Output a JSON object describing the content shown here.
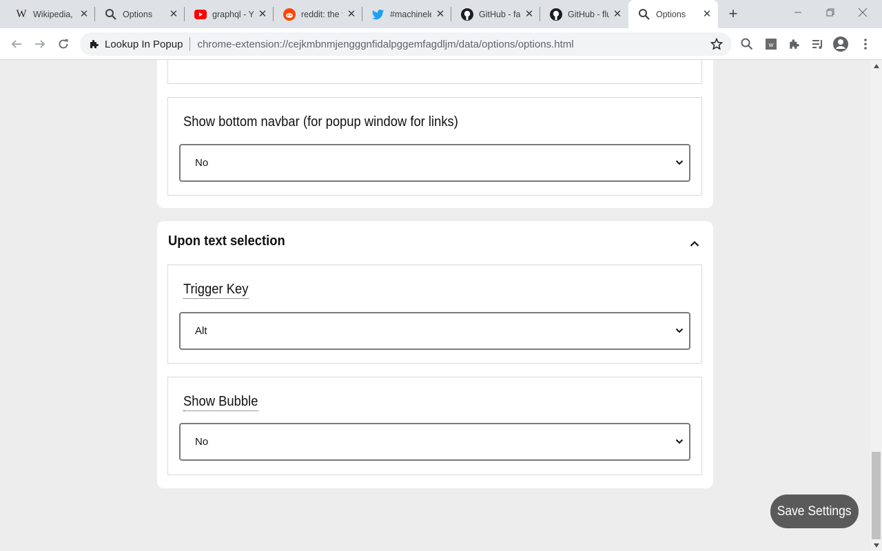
{
  "browser": {
    "tabs": [
      {
        "title": "Wikipedia, t",
        "icon": "wikipedia-icon"
      },
      {
        "title": "Options",
        "icon": "search-icon"
      },
      {
        "title": "graphql - Yo",
        "icon": "youtube-icon"
      },
      {
        "title": "reddit: the f",
        "icon": "reddit-icon"
      },
      {
        "title": "#machinele",
        "icon": "twitter-icon"
      },
      {
        "title": "GitHub - fa",
        "icon": "github-icon"
      },
      {
        "title": "GitHub - flu",
        "icon": "github-icon"
      },
      {
        "title": "Options",
        "icon": "search-icon",
        "active": true
      }
    ],
    "omnibox": {
      "site_name": "Lookup In Popup",
      "url": "chrome-extension://cejkmbnmjengggnfidalpggemfagdljm/data/options/options.html"
    }
  },
  "settings": {
    "section_popup": {
      "navbar_label": "Show bottom navbar (for popup window for links)",
      "navbar_value": "No"
    },
    "section_selection": {
      "title": "Upon text selection",
      "trigger_label": "Trigger Key",
      "trigger_value": "Alt",
      "bubble_label": "Show Bubble",
      "bubble_value": "No"
    }
  },
  "save_button": "Save Settings",
  "colors": {
    "page_bg": "#ededed",
    "card_bg": "#ffffff",
    "save_button_bg": "#5a5a5a",
    "tabstrip_bg": "#dee1e6"
  }
}
